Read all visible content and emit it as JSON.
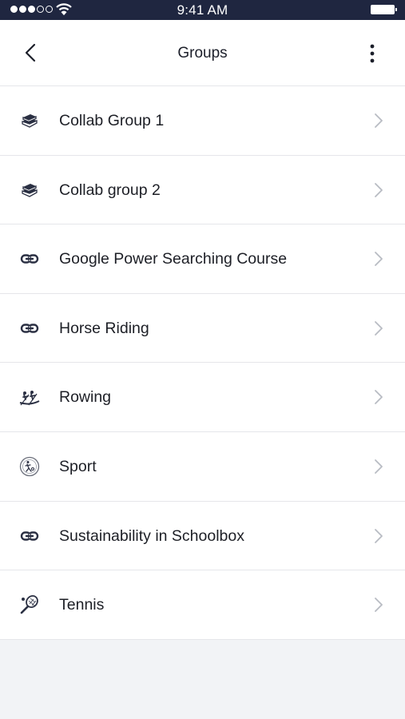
{
  "status_bar": {
    "time": "9:41 AM",
    "signal_bars_filled": 3,
    "signal_bars_total": 5
  },
  "header": {
    "title": "Groups",
    "back_icon": "chevron-left-icon",
    "menu_icon": "more-vertical-icon"
  },
  "groups": [
    {
      "label": "Collab Group 1",
      "icon": "books-icon"
    },
    {
      "label": "Collab group 2",
      "icon": "books-icon"
    },
    {
      "label": "Google Power Searching Course",
      "icon": "link-icon"
    },
    {
      "label": "Horse Riding",
      "icon": "link-icon"
    },
    {
      "label": "Rowing",
      "icon": "rowing-icon"
    },
    {
      "label": "Sport",
      "icon": "sport-emblem-icon"
    },
    {
      "label": "Sustainability in Schoolbox",
      "icon": "link-icon"
    },
    {
      "label": "Tennis",
      "icon": "tennis-racket-icon"
    }
  ],
  "colors": {
    "status_bar": "#1f2640",
    "background": "#f2f3f6",
    "chevron": "#b8bbc3"
  }
}
